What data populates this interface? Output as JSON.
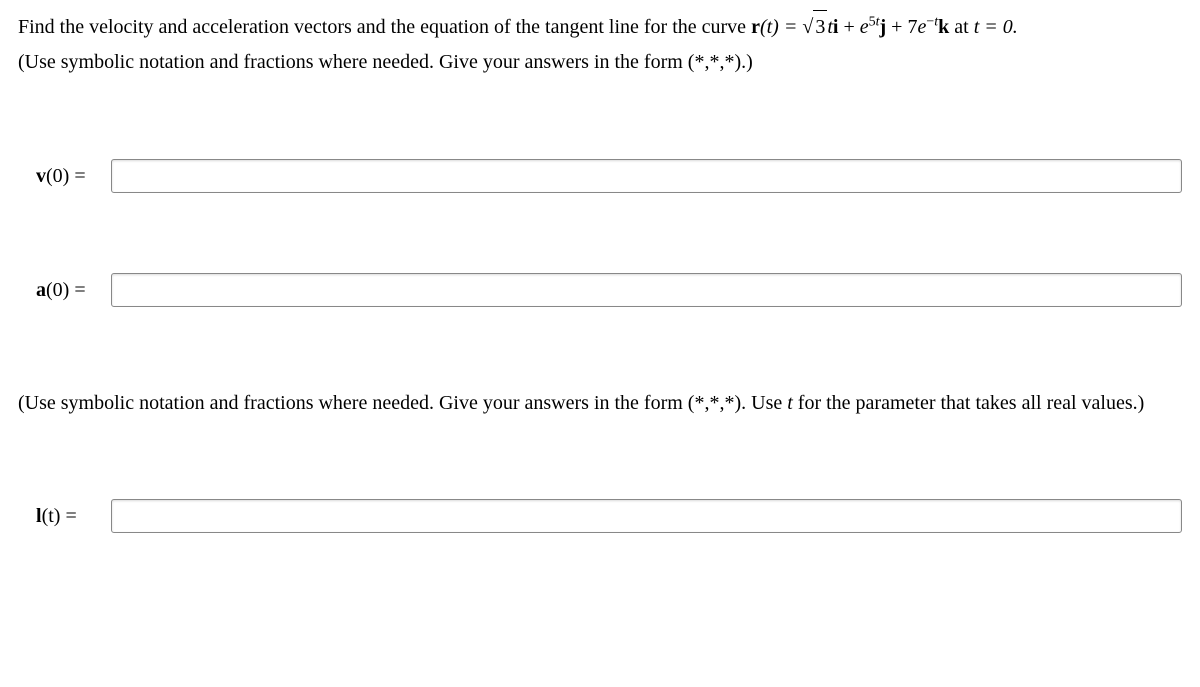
{
  "problem": {
    "intro": "Find the velocity and acceleration vectors and the equation of the tangent line for the curve ",
    "eq_lhs": "r",
    "eq_arg": "(t) = ",
    "coef2": "5",
    "coef3": "7",
    "tail": " at ",
    "t_eq": "t = 0."
  },
  "instruction1": "(Use symbolic notation and fractions where needed. Give your answers in the form (*,*,*).)",
  "labels": {
    "v": "v",
    "a": "a",
    "l": "l"
  },
  "argzero": "(0) =",
  "argt": "(t) =",
  "instruction2_part1": "(Use symbolic notation and fractions where needed. Give your answers in the form (*,*,*). Use ",
  "instruction2_t": "t",
  "instruction2_part2": " for the parameter that takes all real values.)",
  "inputs": {
    "v0": "",
    "a0": "",
    "lt": ""
  }
}
